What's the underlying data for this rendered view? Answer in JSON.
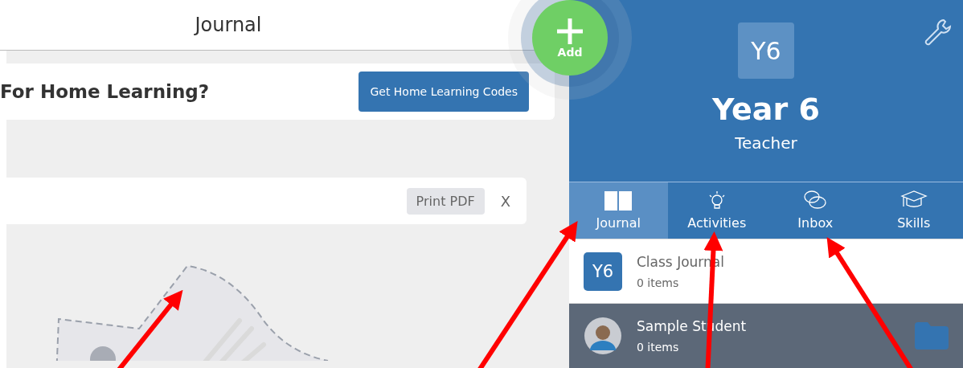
{
  "header": {
    "title": "Journal"
  },
  "banner": {
    "heading": "For Home Learning?",
    "button": "Get Home Learning Codes"
  },
  "toolbar": {
    "print_button": "Print PDF",
    "close_button": "X"
  },
  "add_button": {
    "label": "Add"
  },
  "class_panel": {
    "badge": "Y6",
    "name": "Year 6",
    "role": "Teacher"
  },
  "tabs": [
    {
      "label": "Journal",
      "selected": true
    },
    {
      "label": "Activities",
      "selected": false
    },
    {
      "label": "Inbox",
      "selected": false
    },
    {
      "label": "Skills",
      "selected": false
    }
  ],
  "journals": [
    {
      "kind": "class",
      "badge": "Y6",
      "title": "Class Journal",
      "count": "0 items",
      "selected": false
    },
    {
      "kind": "student",
      "title": "Sample Student",
      "count": "0 items",
      "selected": true
    }
  ]
}
